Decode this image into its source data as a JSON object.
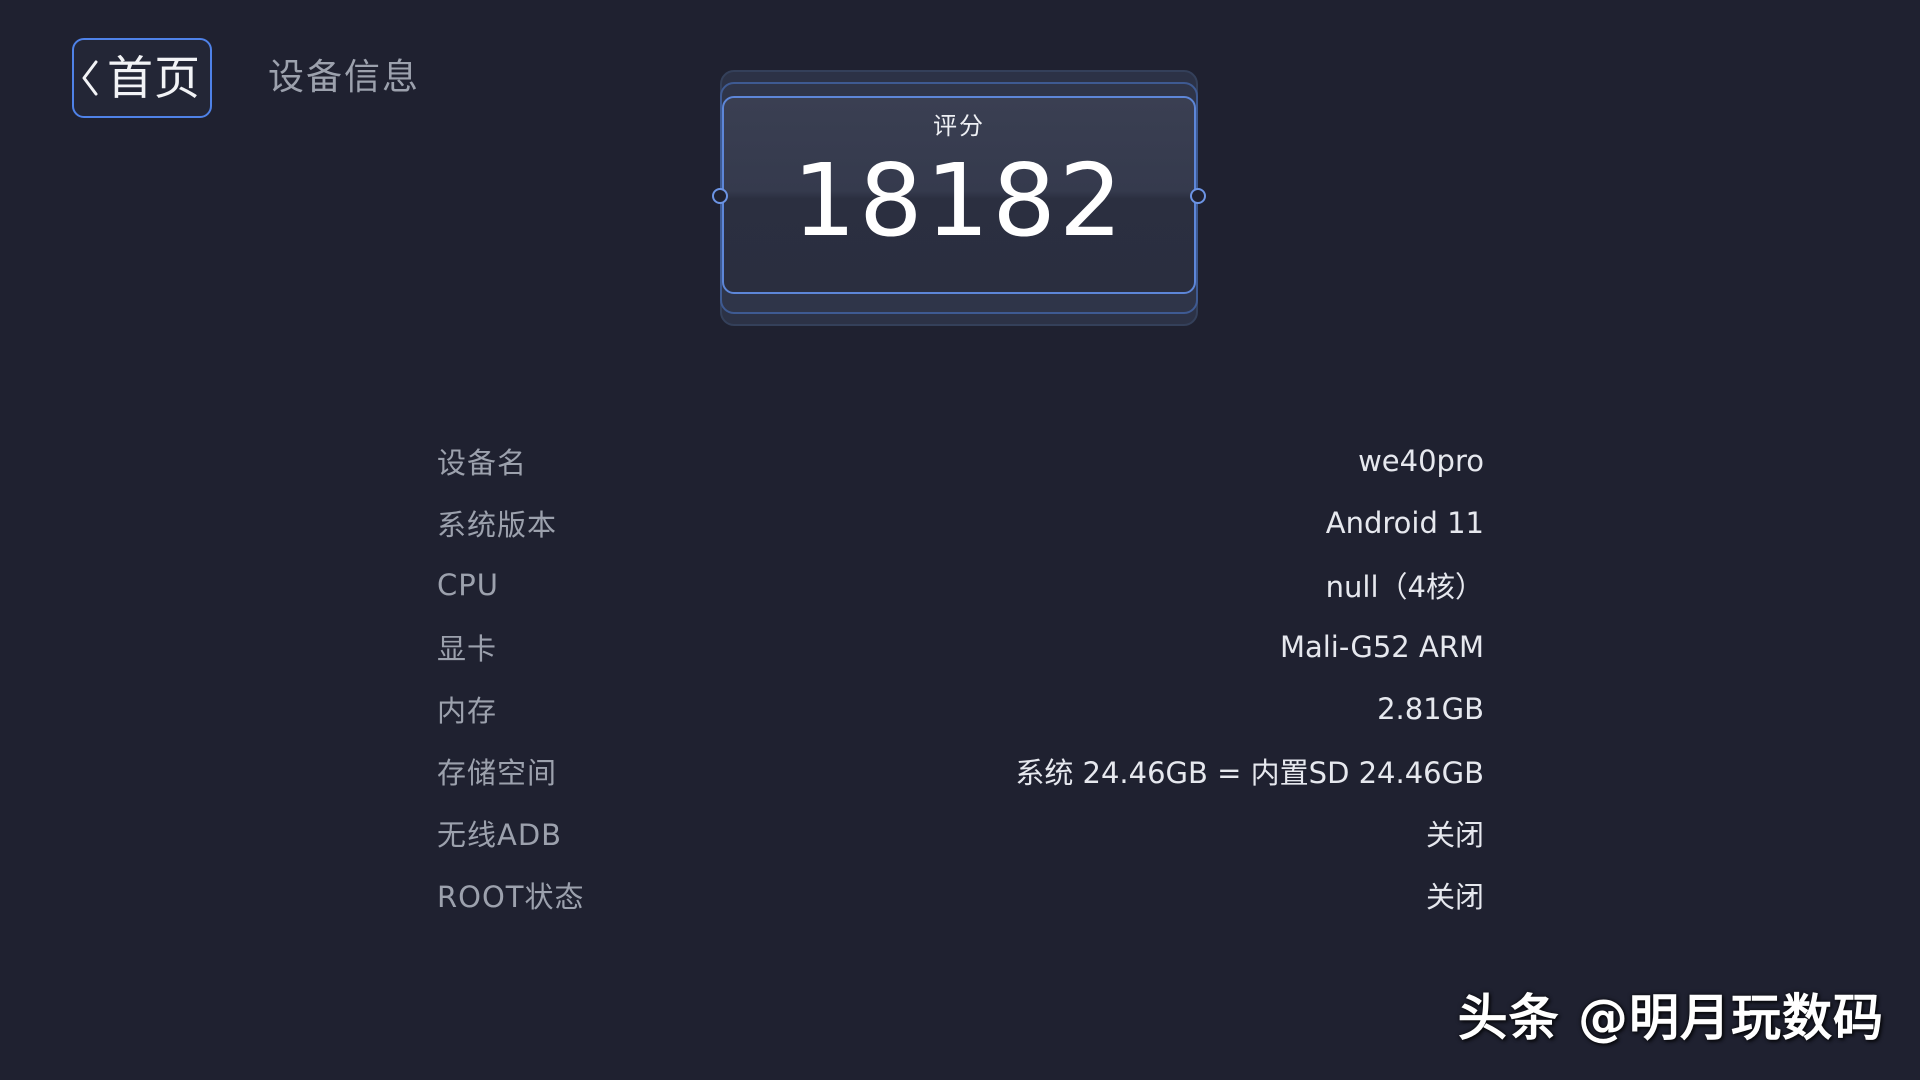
{
  "header": {
    "back_label": "首页",
    "title": "设备信息"
  },
  "score": {
    "label": "评分",
    "value": "18182"
  },
  "device_info": [
    {
      "key": "设备名",
      "value": "we40pro"
    },
    {
      "key": "系统版本",
      "value": "Android 11"
    },
    {
      "key": "CPU",
      "value": "null（4核）"
    },
    {
      "key": "显卡",
      "value": "Mali-G52 ARM"
    },
    {
      "key": "内存",
      "value": "2.81GB"
    },
    {
      "key": "存储空间",
      "value": "系统 24.46GB = 内置SD 24.46GB"
    },
    {
      "key": "无线ADB",
      "value": "关闭"
    },
    {
      "key": "ROOT状态",
      "value": "关闭"
    }
  ],
  "watermark": "头条 @明月玩数码",
  "colors": {
    "background": "#1f2130",
    "accent_border": "#4f82e8",
    "label_text": "#9ca1ad",
    "value_text": "#e6e8ee"
  },
  "icons": {
    "back": "chevron-left-icon"
  }
}
